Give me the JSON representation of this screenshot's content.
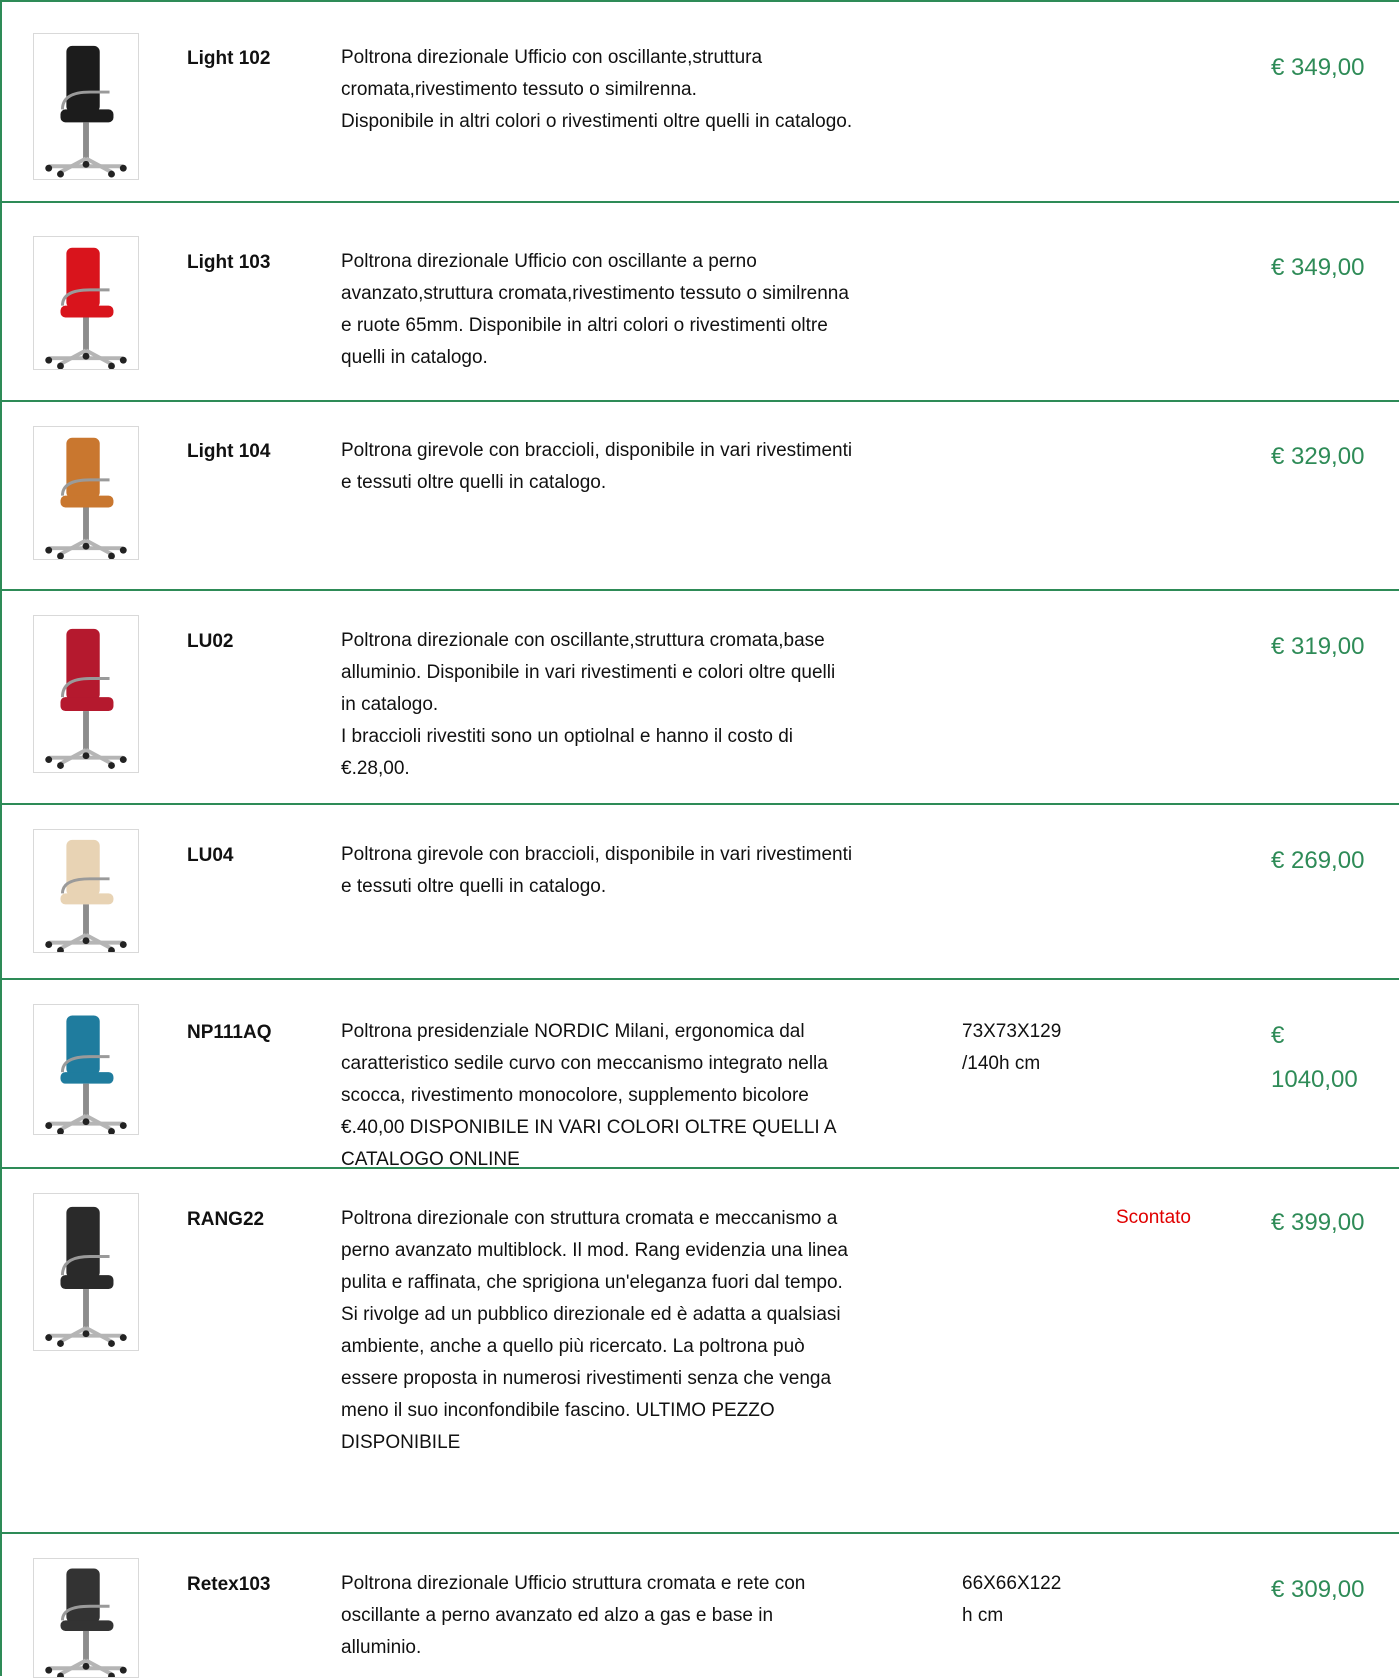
{
  "colors": {
    "border": "#2e8b57",
    "price": "#2e8b57",
    "badge": "#e00000"
  },
  "products": [
    {
      "code": "Light 102",
      "description": "Poltrona direzionale Ufficio con oscillante,struttura\ncromata,rivestimento tessuto o similrenna.\nDisponibile in altri colori o rivestimenti oltre quelli in catalogo.",
      "dimensions": "",
      "badge": "",
      "price": "€ 349,00",
      "image_icon": "black-office-chair-icon",
      "chair_color": "#1c1c1c"
    },
    {
      "code": "Light 103",
      "description": "Poltrona direzionale Ufficio con oscillante a perno\navanzato,struttura cromata,rivestimento tessuto o similrenna\ne ruote 65mm. Disponibile in altri colori o rivestimenti oltre\nquelli in catalogo.",
      "dimensions": "",
      "badge": "",
      "price": "€ 349,00",
      "image_icon": "red-office-chair-icon",
      "chair_color": "#d9141c"
    },
    {
      "code": "Light 104",
      "description": "Poltrona girevole con braccioli, disponibile in vari rivestimenti\ne tessuti oltre quelli in catalogo.",
      "dimensions": "",
      "badge": "",
      "price": "€ 329,00",
      "image_icon": "orange-office-chair-icon",
      "chair_color": "#c9772f"
    },
    {
      "code": "LU02",
      "description": "Poltrona direzionale con oscillante,struttura cromata,base\nalluminio. Disponibile in vari rivestimenti e colori oltre quelli\nin catalogo.\nI braccioli rivestiti sono un optiolnal e hanno il costo di\n€.28,00.",
      "dimensions": "",
      "badge": "",
      "price": "€ 319,00",
      "image_icon": "crimson-office-chair-icon",
      "chair_color": "#b5192e"
    },
    {
      "code": "LU04",
      "description": "Poltrona girevole con braccioli, disponibile in vari rivestimenti\ne tessuti oltre quelli in catalogo.",
      "dimensions": "",
      "badge": "",
      "price": "€ 269,00",
      "image_icon": "beige-office-chair-icon",
      "chair_color": "#e8d3b4"
    },
    {
      "code": "NP111AQ",
      "description": "Poltrona presidenziale NORDIC Milani, ergonomica dal\ncaratteristico sedile curvo con meccanismo integrato nella\nscocca, rivestimento monocolore, supplemento bicolore\n€.40,00 DISPONIBILE IN VARI COLORI OLTRE QUELLI A\nCATALOGO ONLINE",
      "dimensions": "73X73X129\n/140h cm",
      "badge": "",
      "price": "€\n1040,00",
      "image_icon": "teal-armchair-icon",
      "chair_color": "#1f7c9e"
    },
    {
      "code": "RANG22",
      "description": "Poltrona direzionale con struttura cromata e meccanismo a\nperno avanzato multiblock. Il mod. Rang evidenzia una linea\npulita e raffinata, che sprigiona un'eleganza fuori dal tempo.\nSi rivolge ad un pubblico direzionale ed è adatta a qualsiasi\nambiente, anche a quello più ricercato. La poltrona può\nessere proposta in numerosi rivestimenti senza che venga\nmeno il suo inconfondibile fascino. ULTIMO PEZZO\nDISPONIBILE",
      "dimensions": "",
      "badge": "Scontato",
      "price": "€ 399,00",
      "image_icon": "black-leather-chair-icon",
      "chair_color": "#2a2a2a"
    },
    {
      "code": "Retex103",
      "description": "Poltrona direzionale Ufficio struttura cromata e rete con\noscillante a perno avanzato ed alzo a gas e base in\nalluminio.",
      "dimensions": "66X66X122\nh cm",
      "badge": "",
      "price": "€ 309,00",
      "image_icon": "mesh-office-chair-icon",
      "chair_color": "#333333"
    }
  ]
}
